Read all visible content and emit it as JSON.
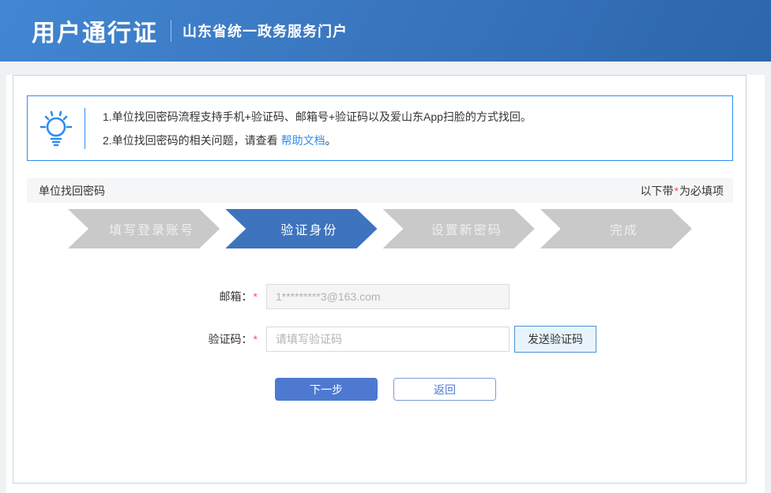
{
  "header": {
    "title": "用户通行证",
    "subtitle": "山东省统一政务服务门户"
  },
  "tip": {
    "icon": "lightbulb-icon",
    "line1": "1.单位找回密码流程支持手机+验证码、邮箱号+验证码以及爱山东App扫脸的方式找回。",
    "line2_prefix": "2.单位找回密码的相关问题，请查看 ",
    "line2_link": "帮助文档",
    "line2_suffix": "。"
  },
  "section": {
    "title": "单位找回密码",
    "required_note_prefix": "以下带",
    "required_star": "*",
    "required_note_suffix": "为必填项"
  },
  "steps": [
    {
      "label": "填写登录账号",
      "active": false
    },
    {
      "label": "验证身份",
      "active": true
    },
    {
      "label": "设置新密码",
      "active": false
    },
    {
      "label": "完成",
      "active": false
    }
  ],
  "form": {
    "email": {
      "label": "邮箱：",
      "required_mark": "*",
      "value": "1*********3@163.com"
    },
    "code": {
      "label": "验证码：",
      "required_mark": "*",
      "placeholder": "请填写验证码",
      "send_button_label": "发送验证码"
    },
    "next_button_label": "下一步",
    "back_button_label": "返回"
  },
  "colors": {
    "accent": "#2d8cf0",
    "step-active": "#3d74bd",
    "step-inactive": "#c9c9c9",
    "btn-primary": "#4d79d0",
    "required": "#ff4d4f",
    "card-border": "#ccd4db"
  }
}
